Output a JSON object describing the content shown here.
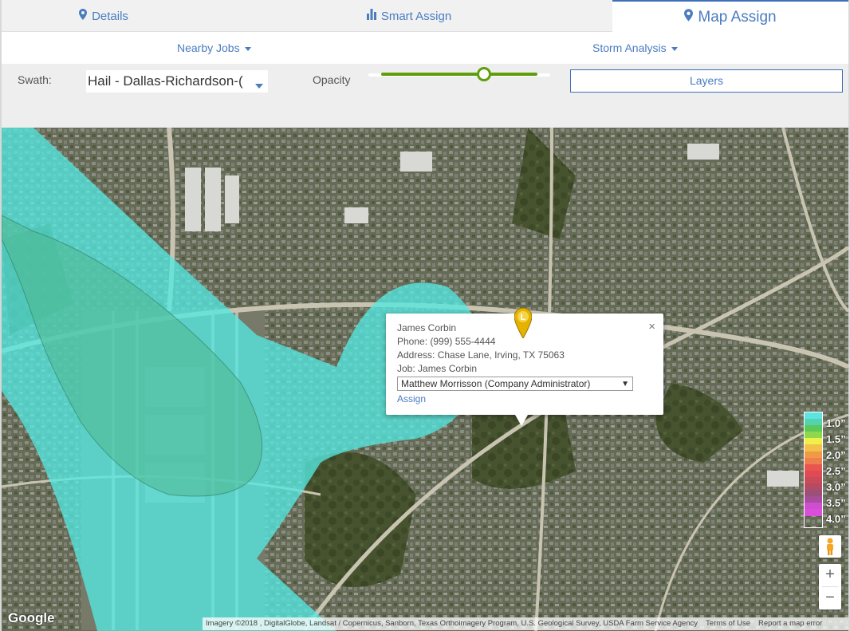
{
  "tabs": [
    {
      "label": "Details",
      "icon": "map-marker-icon"
    },
    {
      "label": "Smart Assign",
      "icon": "bar-chart-icon"
    },
    {
      "label": "Map Assign",
      "icon": "map-marker-icon",
      "active": true
    }
  ],
  "subnav": {
    "nearby_jobs": "Nearby Jobs",
    "storm_analysis": "Storm Analysis"
  },
  "controls": {
    "swath_label": "Swath:",
    "swath_value": "Hail - Dallas-Richardson-(",
    "opacity_label": "Opacity",
    "opacity_value": 0.66,
    "layers_label": "Layers"
  },
  "popup": {
    "name": "James Corbin",
    "phone": "Phone: (999) 555-4444",
    "address": "Address: Chase Lane, Irving, TX 75063",
    "job": "Job: James Corbin",
    "assignee": "Matthew Morrisson (Company Administrator)",
    "assign_label": "Assign",
    "close": "×"
  },
  "marker": {
    "letter": "L",
    "color": "#e5b200"
  },
  "legend": {
    "labels": [
      "1.0”",
      "1.5”",
      "2.0”",
      "2.5”",
      "3.0”",
      "3.5”",
      "4.0”"
    ],
    "colors": [
      "#5fe3e0",
      "#53d4b0",
      "#5cc85a",
      "#8ed84b",
      "#f0f04b",
      "#f2c14a",
      "#f09a48",
      "#ef7f4e",
      "#e8564e",
      "#e04a55",
      "#c94b5a",
      "#b44b63",
      "#9c4f78",
      "#a84d9a",
      "#cf4ed0",
      "#d94fd9"
    ]
  },
  "map_controls": {
    "zoom_in": "+",
    "zoom_out": "−"
  },
  "attribution": {
    "google": "Google",
    "imagery": "Imagery ©2018 , DigitalGlobe, Landsat / Copernicus, Sanborn, Texas Orthoimagery Program, U.S. Geological Survey, USDA Farm Service Agency",
    "terms": "Terms of Use",
    "report": "Report a map error"
  }
}
